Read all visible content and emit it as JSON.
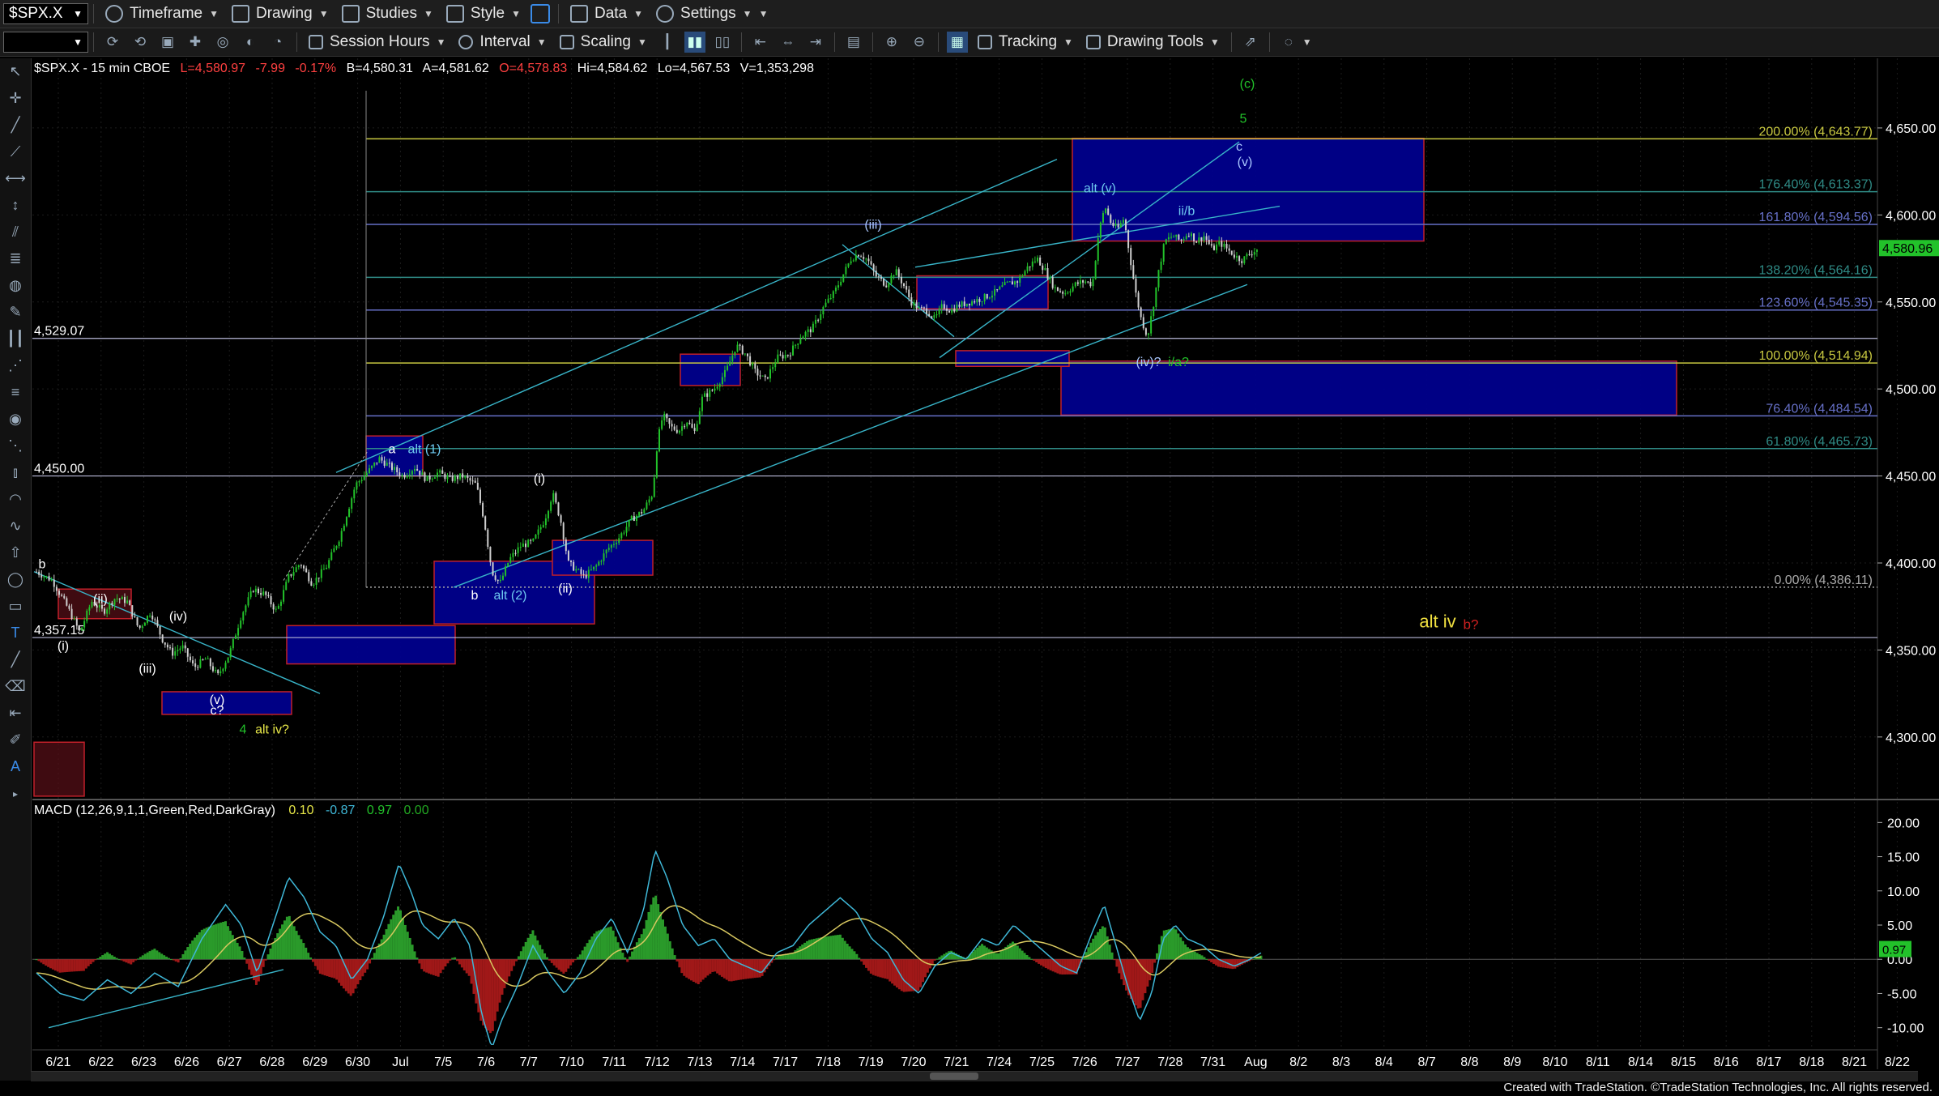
{
  "toolbar1": {
    "symbol": "$SPX.X",
    "timeframe": "Timeframe",
    "drawing": "Drawing",
    "studies": "Studies",
    "style": "Style",
    "data": "Data",
    "settings": "Settings"
  },
  "toolbar2": {
    "session_hours": "Session Hours",
    "interval": "Interval",
    "scaling": "Scaling",
    "tracking": "Tracking",
    "drawing_tools": "Drawing Tools"
  },
  "status_line": {
    "symbol_info": "$SPX.X - 15 min  CBOE",
    "last": "L=4,580.97",
    "change": "-7.99",
    "change_pct": "-0.17%",
    "bid": "B=4,580.31",
    "ask": "A=4,581.62",
    "open": "O=4,578.83",
    "high": "Hi=4,584.62",
    "low": "Lo=4,567.53",
    "volume": "V=1,353,298"
  },
  "macd_label": {
    "name": "MACD (12,26,9,1,1,Green,Red,DarkGray)",
    "v1": "0.10",
    "v2": "-0.87",
    "v3": "0.97",
    "v4": "0.00"
  },
  "footer": "Created with TradeStation. ©TradeStation Technologies, Inc. All rights reserved.",
  "colors": {
    "bull": "#22c22a",
    "bear": "#cfcfcf",
    "zone_fill": "#00008c",
    "zone_border": "#c0202a",
    "fib_yellow": "#c8c840",
    "fib_teal": "#2f8a85",
    "fib_blue": "#6670c8",
    "channel": "#38b4c8",
    "macd_hist_pos": "#2a9a2a",
    "macd_hist_neg": "#a01818",
    "macd_line": "#3fb8d8",
    "signal_line": "#d8c860"
  },
  "chart_data": [
    {
      "type": "candlestick",
      "interval": "15 min",
      "ylim": [
        4265,
        4690
      ],
      "y_ticks": [
        "4,650.00",
        "4,600.00",
        "4,550.00",
        "4,500.00",
        "4,450.00",
        "4,400.00",
        "4,350.00",
        "4,300.00"
      ],
      "y_tick_values": [
        4650,
        4600,
        4550,
        4500,
        4450,
        4400,
        4350,
        4300
      ],
      "x_ticks": [
        "6/21",
        "6/22",
        "6/23",
        "6/26",
        "6/27",
        "6/28",
        "6/29",
        "6/30",
        "Jul",
        "7/5",
        "7/6",
        "7/7",
        "7/10",
        "7/11",
        "7/12",
        "7/13",
        "7/14",
        "7/17",
        "7/18",
        "7/19",
        "7/20",
        "7/21",
        "7/24",
        "7/25",
        "7/26",
        "7/27",
        "7/28",
        "7/31",
        "Aug",
        "8/2",
        "8/3",
        "8/4",
        "8/7",
        "8/8",
        "8/9",
        "8/10",
        "8/11",
        "8/14",
        "8/15",
        "8/16",
        "8/17",
        "8/18",
        "8/21",
        "8/22"
      ],
      "last_price": "4,580.96",
      "last_price_value": 4580.96,
      "price_path": [
        [
          0,
          4395
        ],
        [
          20,
          4390
        ],
        [
          40,
          4374
        ],
        [
          55,
          4360
        ],
        [
          70,
          4378
        ],
        [
          85,
          4372
        ],
        [
          100,
          4380
        ],
        [
          115,
          4378
        ],
        [
          130,
          4362
        ],
        [
          145,
          4372
        ],
        [
          160,
          4356
        ],
        [
          172,
          4348
        ],
        [
          185,
          4352
        ],
        [
          200,
          4340
        ],
        [
          215,
          4345
        ],
        [
          230,
          4335
        ],
        [
          245,
          4348
        ],
        [
          260,
          4370
        ],
        [
          275,
          4385
        ],
        [
          290,
          4382
        ],
        [
          305,
          4372
        ],
        [
          320,
          4392
        ],
        [
          335,
          4400
        ],
        [
          350,
          4388
        ],
        [
          368,
          4398
        ],
        [
          385,
          4415
        ],
        [
          395,
          4430
        ],
        [
          405,
          4445
        ],
        [
          420,
          4452
        ],
        [
          435,
          4460
        ],
        [
          450,
          4455
        ],
        [
          465,
          4450
        ],
        [
          480,
          4455
        ],
        [
          495,
          4448
        ],
        [
          510,
          4452
        ],
        [
          525,
          4448
        ],
        [
          540,
          4450
        ],
        [
          558,
          4445
        ],
        [
          568,
          4425
        ],
        [
          578,
          4395
        ],
        [
          588,
          4388
        ],
        [
          600,
          4402
        ],
        [
          615,
          4410
        ],
        [
          630,
          4412
        ],
        [
          645,
          4425
        ],
        [
          655,
          4440
        ],
        [
          665,
          4425
        ],
        [
          675,
          4400
        ],
        [
          685,
          4396
        ],
        [
          695,
          4392
        ],
        [
          710,
          4398
        ],
        [
          725,
          4408
        ],
        [
          740,
          4415
        ],
        [
          755,
          4425
        ],
        [
          770,
          4430
        ],
        [
          782,
          4440
        ],
        [
          788,
          4470
        ],
        [
          795,
          4485
        ],
        [
          805,
          4478
        ],
        [
          815,
          4476
        ],
        [
          825,
          4482
        ],
        [
          835,
          4475
        ],
        [
          845,
          4495
        ],
        [
          860,
          4500
        ],
        [
          875,
          4510
        ],
        [
          888,
          4525
        ],
        [
          900,
          4520
        ],
        [
          912,
          4510
        ],
        [
          925,
          4505
        ],
        [
          940,
          4518
        ],
        [
          955,
          4520
        ],
        [
          970,
          4530
        ],
        [
          985,
          4535
        ],
        [
          1000,
          4548
        ],
        [
          1012,
          4555
        ],
        [
          1024,
          4566
        ],
        [
          1034,
          4575
        ],
        [
          1044,
          4578
        ],
        [
          1055,
          4574
        ],
        [
          1065,
          4565
        ],
        [
          1078,
          4560
        ],
        [
          1090,
          4568
        ],
        [
          1100,
          4560
        ],
        [
          1110,
          4550
        ],
        [
          1120,
          4546
        ],
        [
          1130,
          4545
        ],
        [
          1140,
          4540
        ],
        [
          1150,
          4548
        ],
        [
          1160,
          4545
        ],
        [
          1170,
          4548
        ],
        [
          1185,
          4550
        ],
        [
          1200,
          4552
        ],
        [
          1215,
          4555
        ],
        [
          1230,
          4560
        ],
        [
          1245,
          4562
        ],
        [
          1258,
          4570
        ],
        [
          1270,
          4575
        ],
        [
          1280,
          4568
        ],
        [
          1292,
          4558
        ],
        [
          1305,
          4555
        ],
        [
          1318,
          4560
        ],
        [
          1330,
          4562
        ],
        [
          1340,
          4560
        ],
        [
          1348,
          4590
        ],
        [
          1356,
          4605
        ],
        [
          1364,
          4595
        ],
        [
          1372,
          4592
        ],
        [
          1380,
          4598
        ],
        [
          1388,
          4575
        ],
        [
          1395,
          4555
        ],
        [
          1402,
          4540
        ],
        [
          1410,
          4530
        ],
        [
          1418,
          4550
        ],
        [
          1425,
          4570
        ],
        [
          1432,
          4585
        ],
        [
          1442,
          4588
        ],
        [
          1452,
          4585
        ],
        [
          1462,
          4590
        ],
        [
          1472,
          4585
        ],
        [
          1482,
          4588
        ],
        [
          1492,
          4580
        ],
        [
          1502,
          4584
        ],
        [
          1512,
          4580
        ],
        [
          1522,
          4576
        ],
        [
          1530,
          4574
        ],
        [
          1540,
          4578
        ],
        [
          1552,
          4581
        ]
      ],
      "fib_levels": [
        {
          "label": "200.00% (4,643.77)",
          "value": 4643.77,
          "color": "yellow"
        },
        {
          "label": "176.40% (4,613.37)",
          "value": 4613.37,
          "color": "teal"
        },
        {
          "label": "161.80% (4,594.56)",
          "value": 4594.56,
          "color": "blue"
        },
        {
          "label": "138.20% (4,564.16)",
          "value": 4564.16,
          "color": "teal"
        },
        {
          "label": "123.60% (4,545.35)",
          "value": 4545.35,
          "color": "blue"
        },
        {
          "label": "100.00% (4,514.94)",
          "value": 4514.94,
          "color": "yellow"
        },
        {
          "label": "76.40% (4,484.54)",
          "value": 4484.54,
          "color": "blue"
        },
        {
          "label": "61.80% (4,465.73)",
          "value": 4465.73,
          "color": "teal"
        },
        {
          "label": "0.00% (4,386.11)",
          "value": 4386.11,
          "color": "gray"
        }
      ],
      "horizontal_levels": [
        {
          "label": "4,529.07",
          "value": 4529.07
        },
        {
          "label": "4,450.00",
          "value": 4450.0
        },
        {
          "label": "4,357.15",
          "value": 4357.15
        }
      ],
      "annotations": [
        {
          "text": "(c)",
          "color": "#22c22a"
        },
        {
          "text": "5",
          "color": "#22c22a"
        },
        {
          "text": "c",
          "color": "#aac8ff"
        },
        {
          "text": "(v)",
          "color": "#aac8ff"
        },
        {
          "text": "alt (v)",
          "color": "#6ec8f0"
        },
        {
          "text": "ii/b",
          "color": "#6ec8f0"
        },
        {
          "text": "(iii)",
          "color": "#aac8ff"
        },
        {
          "text": "(iv)?",
          "color": "#aac8ff"
        },
        {
          "text": "i/a?",
          "color": "#22c22a"
        },
        {
          "text": "a",
          "color": "#ffffff"
        },
        {
          "text": "alt (1)",
          "color": "#6ec8f0"
        },
        {
          "text": "(i)",
          "color": "#ffffff"
        },
        {
          "text": "b",
          "color": "#ffffff"
        },
        {
          "text": "alt (2)",
          "color": "#6ec8f0"
        },
        {
          "text": "(ii)",
          "color": "#ffffff"
        },
        {
          "text": "b",
          "color": "#ffffff"
        },
        {
          "text": "(ii)",
          "color": "#ffffff"
        },
        {
          "text": "(i)",
          "color": "#ffffff"
        },
        {
          "text": "(iv)",
          "color": "#ffffff"
        },
        {
          "text": "(iii)",
          "color": "#ffffff"
        },
        {
          "text": "(v)",
          "color": "#ffffff"
        },
        {
          "text": "c?",
          "color": "#ffffff"
        },
        {
          "text": "4",
          "color": "#22c22a"
        },
        {
          "text": "alt iv?",
          "color": "#e8e848"
        },
        {
          "text": "alt iv",
          "color": "#f0e040"
        },
        {
          "text": "b?",
          "color": "#d02020"
        }
      ]
    },
    {
      "type": "macd",
      "ylim": [
        -13,
        23
      ],
      "y_ticks": [
        "20.00",
        "15.00",
        "10.00",
        "5.00",
        "0.00",
        "-5.00",
        "-10.00"
      ],
      "y_tick_values": [
        20,
        15,
        10,
        5,
        0,
        -5,
        -10
      ],
      "macd_current": "0.97",
      "macd_path": [
        [
          0,
          -2
        ],
        [
          30,
          -5
        ],
        [
          60,
          -6
        ],
        [
          90,
          -3
        ],
        [
          120,
          -5
        ],
        [
          150,
          -2
        ],
        [
          180,
          -4
        ],
        [
          210,
          3
        ],
        [
          240,
          8
        ],
        [
          260,
          5
        ],
        [
          280,
          -2
        ],
        [
          300,
          5
        ],
        [
          320,
          12
        ],
        [
          340,
          9
        ],
        [
          360,
          4
        ],
        [
          380,
          2
        ],
        [
          400,
          -3
        ],
        [
          420,
          0
        ],
        [
          440,
          6
        ],
        [
          460,
          14
        ],
        [
          475,
          10
        ],
        [
          490,
          5
        ],
        [
          510,
          3
        ],
        [
          530,
          6
        ],
        [
          550,
          2
        ],
        [
          565,
          -8
        ],
        [
          578,
          -13
        ],
        [
          590,
          -9
        ],
        [
          610,
          -4
        ],
        [
          630,
          2
        ],
        [
          650,
          -2
        ],
        [
          670,
          -5
        ],
        [
          690,
          -2
        ],
        [
          710,
          3
        ],
        [
          730,
          6
        ],
        [
          750,
          1
        ],
        [
          770,
          7
        ],
        [
          785,
          16
        ],
        [
          800,
          12
        ],
        [
          820,
          5
        ],
        [
          840,
          2
        ],
        [
          860,
          3
        ],
        [
          880,
          0
        ],
        [
          900,
          -1
        ],
        [
          920,
          -2
        ],
        [
          940,
          1
        ],
        [
          960,
          2
        ],
        [
          980,
          5
        ],
        [
          1000,
          7
        ],
        [
          1020,
          9
        ],
        [
          1040,
          7
        ],
        [
          1060,
          3
        ],
        [
          1080,
          1
        ],
        [
          1100,
          -3
        ],
        [
          1120,
          -5
        ],
        [
          1140,
          -1
        ],
        [
          1160,
          1
        ],
        [
          1180,
          0
        ],
        [
          1200,
          3
        ],
        [
          1220,
          2
        ],
        [
          1240,
          5
        ],
        [
          1260,
          3
        ],
        [
          1280,
          1
        ],
        [
          1300,
          -1
        ],
        [
          1320,
          -2
        ],
        [
          1340,
          4
        ],
        [
          1355,
          8
        ],
        [
          1370,
          2
        ],
        [
          1385,
          -4
        ],
        [
          1400,
          -9
        ],
        [
          1415,
          -5
        ],
        [
          1430,
          3
        ],
        [
          1445,
          5
        ],
        [
          1460,
          3
        ],
        [
          1480,
          2
        ],
        [
          1500,
          0
        ],
        [
          1520,
          -1
        ],
        [
          1540,
          0
        ],
        [
          1555,
          1
        ]
      ]
    }
  ]
}
